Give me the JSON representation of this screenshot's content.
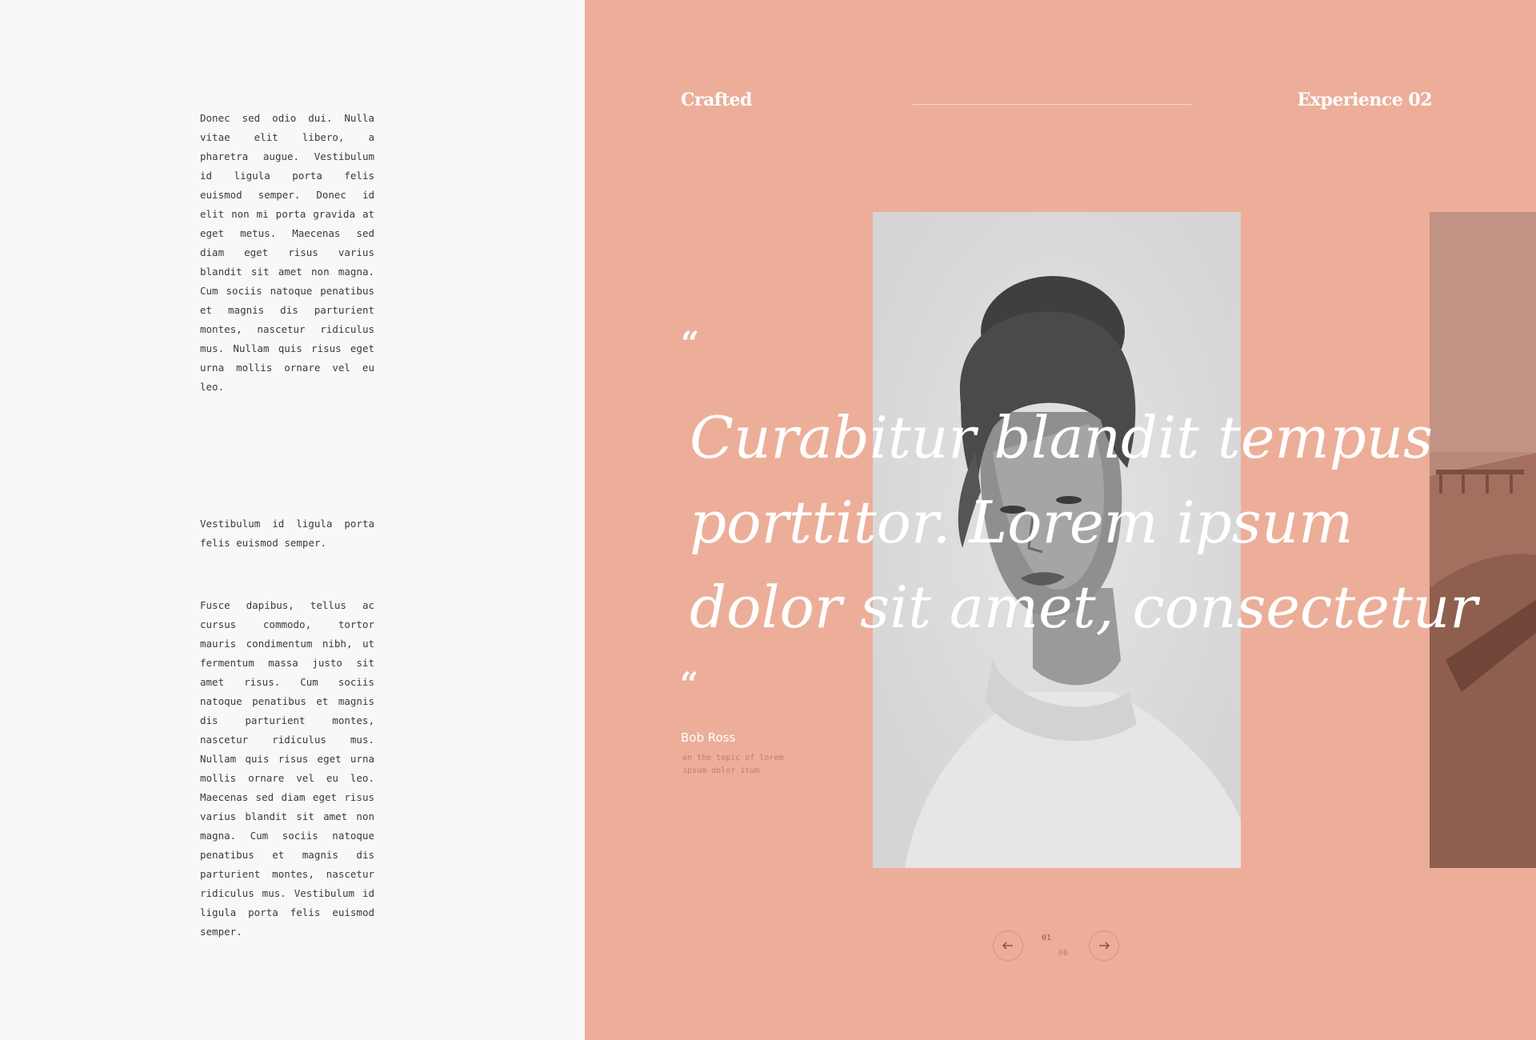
{
  "left_column": {
    "paragraph_1": "Donec sed odio dui. Nulla vitae elit libero, a pharetra augue. Vestibulum id ligula porta felis euismod semper. Donec id elit non mi porta gravida at eget metus. Maecenas sed diam eget risus varius blandit sit amet non magna. Cum sociis natoque penatibus et magnis dis parturient montes, nascetur ridiculus mus. Nullam quis risus eget urna mollis ornare vel eu leo.",
    "paragraph_2": "Vestibulum id ligula porta felis euismod semper.",
    "paragraph_3": "Fusce dapibus, tellus ac cursus commodo, tortor mauris condimentum nibh, ut fermentum massa justo sit amet risus. Cum sociis natoque penatibus et magnis dis parturient montes, nascetur ridiculus mus. Nullam quis risus eget urna mollis ornare vel eu leo. Maecenas sed diam eget risus varius blandit sit amet non magna. Cum sociis natoque penatibus et magnis dis parturient montes, nascetur ridiculus mus. Vestibulum id ligula porta felis euismod semper."
  },
  "header": {
    "brand": "Crafted",
    "experience": "Experience 02"
  },
  "quote": {
    "open_mark": "“",
    "close_mark": "“",
    "line_1": "Curabitur blandit tempus",
    "line_2": "porttitor. Lorem ipsum",
    "line_3": "dolor sit amet, consectetur",
    "author": "Bob Ross",
    "author_note_1": "on the topic of lorem",
    "author_note_2": "ipsum dolor itum"
  },
  "pager": {
    "current": "01",
    "total": "08",
    "prev_icon": "arrow-left-icon",
    "next_icon": "arrow-right-icon"
  },
  "colors": {
    "accent_panel": "#ecae99",
    "left_background": "#f8f8f8",
    "body_text": "#3a3a3a",
    "quote_text": "#ffffff"
  }
}
